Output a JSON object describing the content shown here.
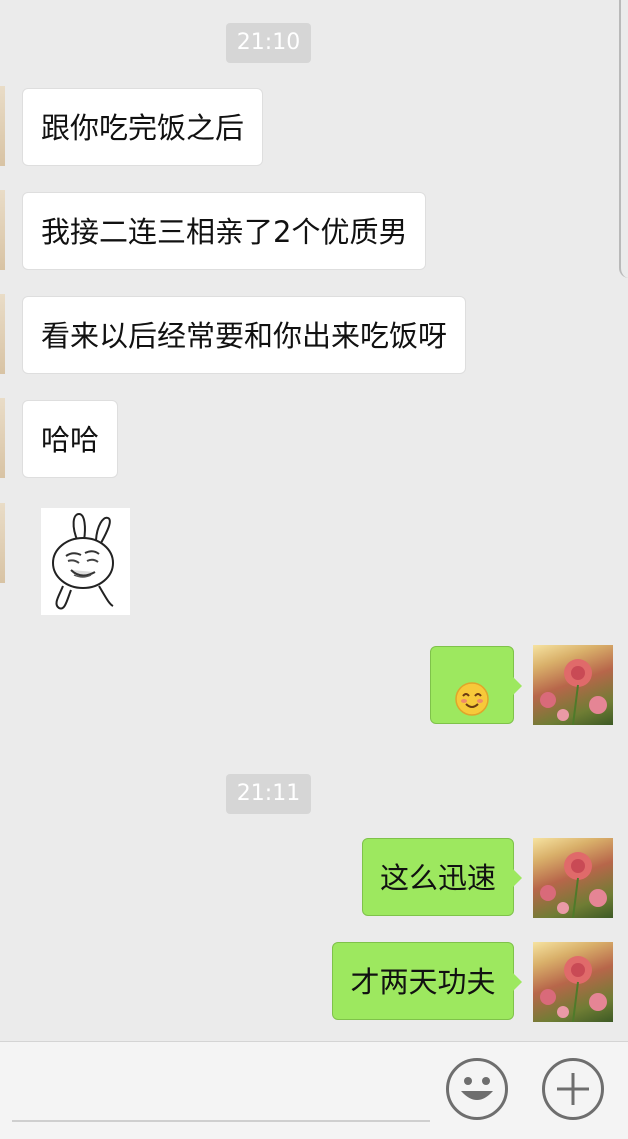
{
  "timestamps": [
    "21:10",
    "21:11"
  ],
  "messages_in": [
    "跟你吃完饭之后",
    "我接二连三相亲了2个优质男",
    "看来以后经常要和你出来吃饭呀",
    "哈哈"
  ],
  "messages_out": [
    "这么迅速",
    "才两天功夫"
  ],
  "icons": {
    "sticker": "rabbit-meme-sticker",
    "emoji": "smiling-face-emoji",
    "avatar": "pink-flower-avatar",
    "emoji_button": "smiley-face-icon",
    "plus_button": "plus-icon"
  },
  "colors": {
    "background": "#ebebeb",
    "bubble_in": "#ffffff",
    "bubble_out": "#9de85f",
    "timestamp_bg": "#d6d6d6"
  }
}
